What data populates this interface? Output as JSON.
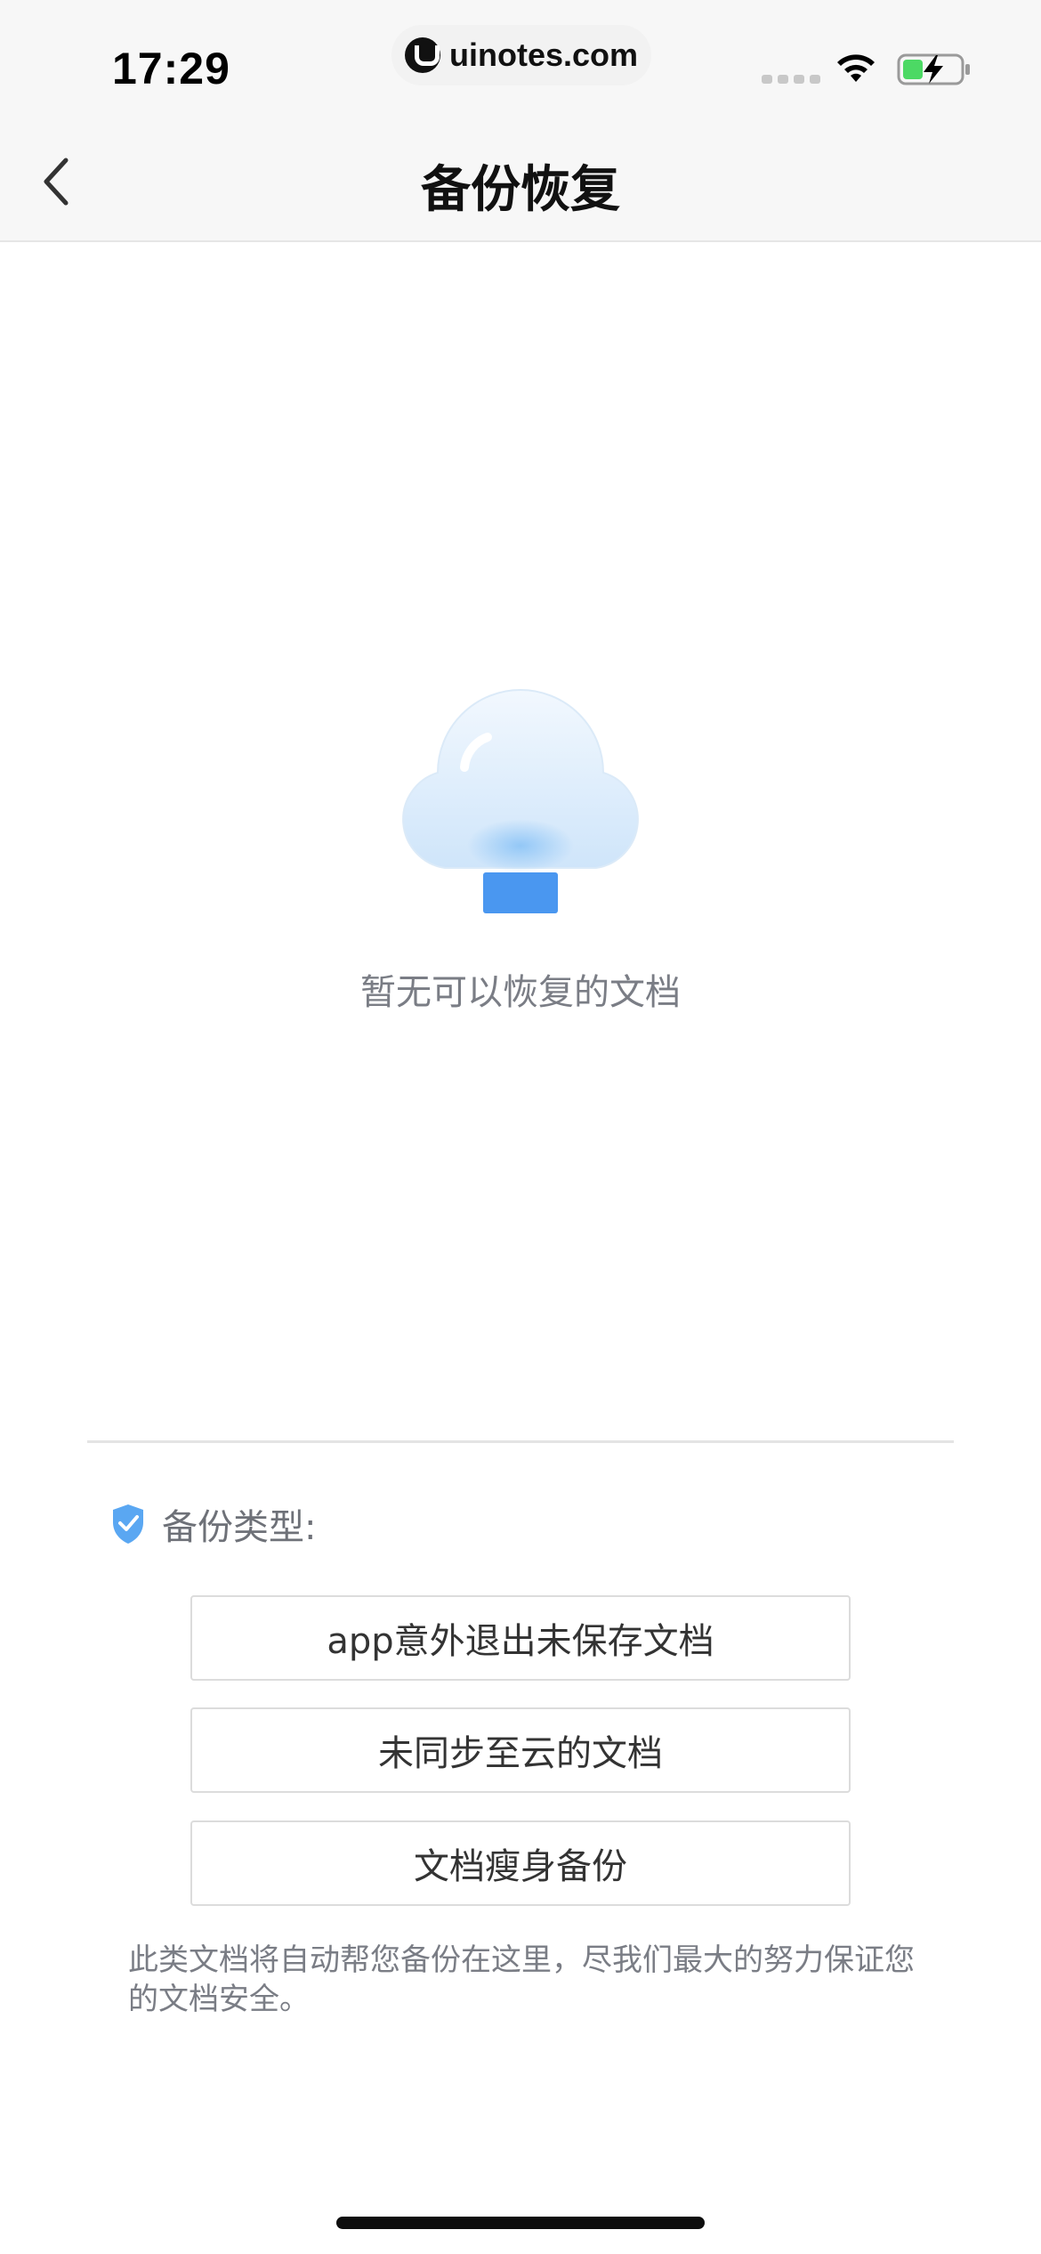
{
  "status_bar": {
    "time": "17:29",
    "url": "uinotes.com",
    "battery_color": "#4cd964"
  },
  "nav": {
    "title": "备份恢复",
    "back_icon": "chevron-left-icon"
  },
  "empty_state": {
    "illustration": "cloud-icon",
    "message": "暂无可以恢复的文档"
  },
  "backup_types": {
    "label": "备份类型:",
    "icon": "shield-check-icon",
    "items": [
      {
        "label": "app意外退出未保存文档"
      },
      {
        "label": "未同步至云的文档"
      },
      {
        "label": "文档瘦身备份"
      }
    ]
  },
  "footer_note": "此类文档将自动帮您备份在这里，尽我们最大的努力保证您的文档安全。",
  "colors": {
    "accent": "#4a97f0",
    "muted_text": "#7a7d85"
  }
}
